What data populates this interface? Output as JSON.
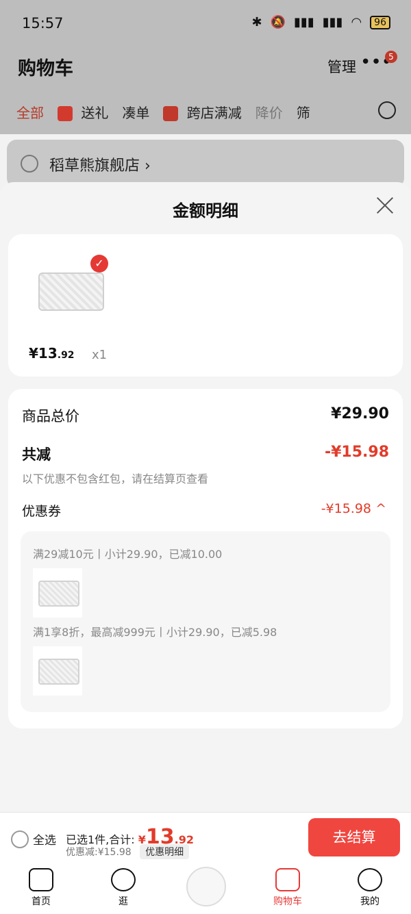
{
  "status_bar": {
    "time": "15:57",
    "battery": "96"
  },
  "header": {
    "title": "购物车",
    "manage": "管理",
    "badge_count": "5"
  },
  "filter_tabs": [
    {
      "label": "全部",
      "icon": ""
    },
    {
      "label": "送礼",
      "icon": "gift-icon"
    },
    {
      "label": "凑单",
      "icon": ""
    },
    {
      "label": "跨店满减",
      "icon": "promo-icon"
    },
    {
      "label": "降价",
      "icon": ""
    },
    {
      "label": "筛",
      "icon": ""
    }
  ],
  "shop": {
    "name": "稻草熊旗舰店",
    "chevron": "›"
  },
  "sheet": {
    "title": "金额明细",
    "product": {
      "price_main": "¥13",
      "price_decimal": ".92",
      "qty": "x1"
    },
    "details": {
      "subtotal_label": "商品总价",
      "subtotal_value": "¥29.90",
      "discount_label": "共减",
      "discount_value": "-¥15.98",
      "note": "以下优惠不包含红包，请在结算页查看",
      "coupon_label": "优惠券",
      "coupon_value": "-¥15.98",
      "coupon_toggle": "^",
      "coupon_rules": [
        "满29减10元丨小计29.90，已减10.00",
        "满1享8折，最高减999元丨小计29.90，已减5.98"
      ]
    }
  },
  "bottom_bar": {
    "select_all": "全选",
    "selected_prefix": "已选1件,合计:",
    "currency": "¥",
    "amount_main": "13",
    "amount_decimal": ".92",
    "discount_text": "优惠减:¥15.98",
    "detail_tag": "优惠明细",
    "checkout": "去结算"
  },
  "tabbar": [
    {
      "label": "首页",
      "icon": "home-icon"
    },
    {
      "label": "逛",
      "icon": "face-icon"
    },
    {
      "label": "",
      "icon": "promo-bubble-icon"
    },
    {
      "label": "购物车",
      "icon": "cart-icon"
    },
    {
      "label": "我的",
      "icon": "user-icon"
    }
  ],
  "colors": {
    "accent": "#e23b2a",
    "checkout": "#f04640"
  }
}
